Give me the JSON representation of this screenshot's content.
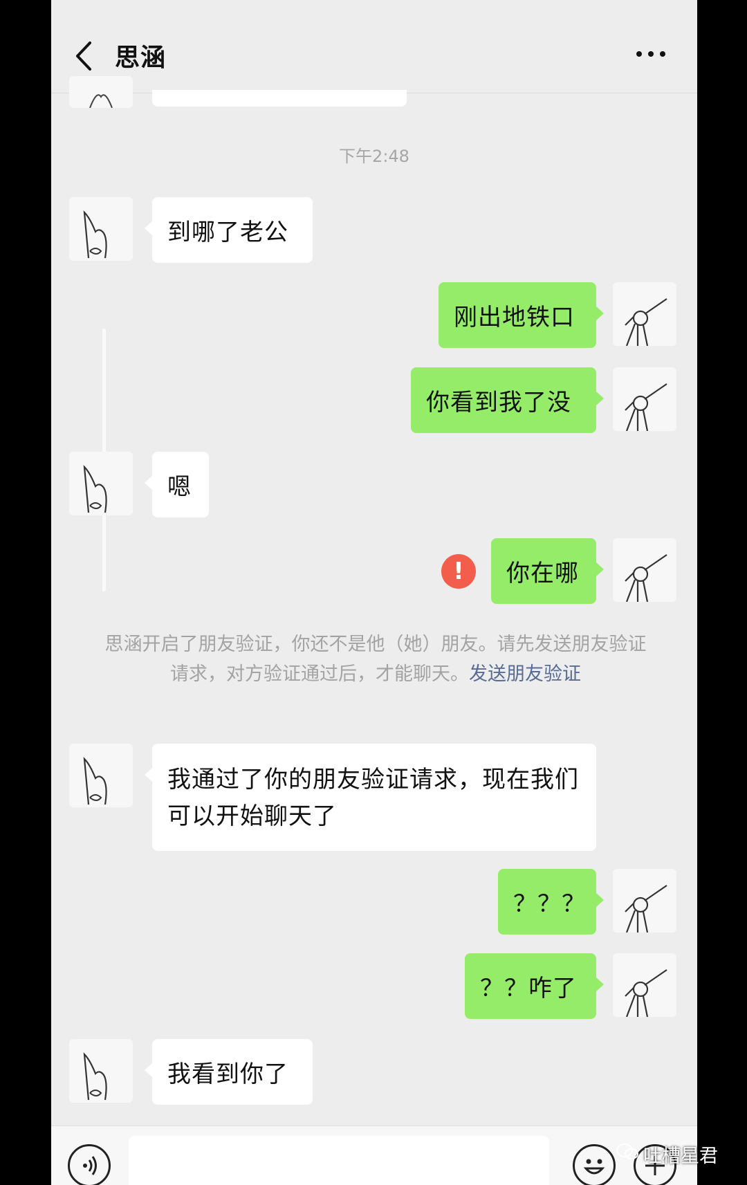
{
  "header": {
    "title": "思涵"
  },
  "timestamp": "下午2:48",
  "messages": [
    {
      "dir": "in",
      "text": "到哪了老公"
    },
    {
      "dir": "out",
      "text": "刚出地铁口"
    },
    {
      "dir": "out",
      "text": "你看到我了没"
    },
    {
      "dir": "in",
      "text": "嗯"
    },
    {
      "dir": "out",
      "text": "你在哪",
      "failed": true
    },
    {
      "dir": "in",
      "text": "我通过了你的朋友验证请求，现在我们可以开始聊天了"
    },
    {
      "dir": "out",
      "text": "？？？"
    },
    {
      "dir": "out",
      "text": "？？咋了"
    },
    {
      "dir": "in",
      "text": "我看到你了"
    }
  ],
  "system_notice": {
    "text": "思涵开启了朋友验证，你还不是他（她）朋友。请先发送朋友验证请求，对方验证通过后，才能聊天。",
    "link": "发送朋友验证"
  },
  "error_mark": "!",
  "watermark": "吐槽星君",
  "colors": {
    "background": "#ededed",
    "outgoing_bubble": "#95ec69",
    "incoming_bubble": "#ffffff",
    "error": "#f25d4c",
    "link": "#576b95"
  },
  "icons": [
    "back-chevron-icon",
    "more-dots-icon",
    "voice-icon",
    "emoji-icon",
    "plus-icon",
    "wechat-logo-icon"
  ]
}
